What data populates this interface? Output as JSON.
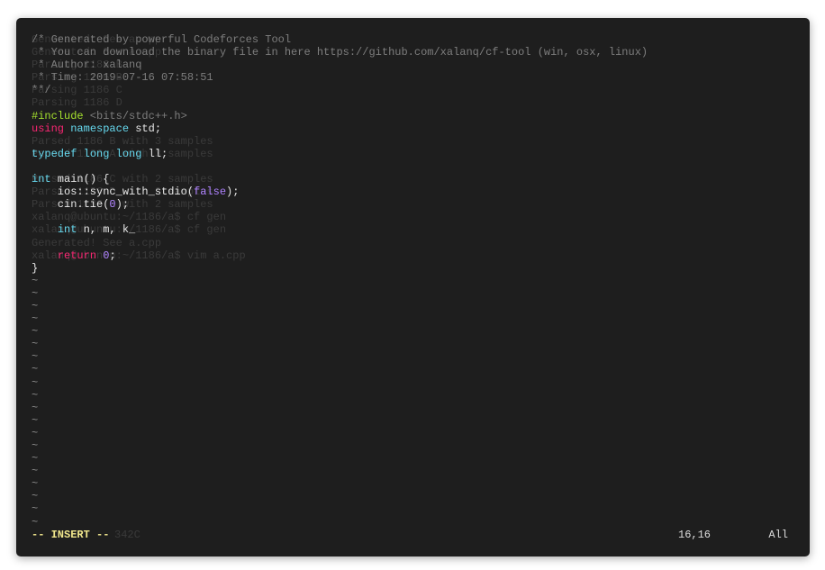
{
  "background_output": [
    "Generated: See a.cpp",
    "Generated: See a.cpp",
    "Parsing 1186 B",
    "Parsing 1186 B",
    "Parsing 1186 C",
    "Parsing 1186 D",
    "",
    "",
    "Parsed 1186 B with 3 samples",
    "Parsed 1186 A with 3 samples",
    "",
    "Parsed 1186 C with 2 samples",
    "Parsed 1186 D with 2 samples",
    "Parsed 1186 E with 2 samples",
    "xalanq@ubuntu:~/1186/a$ cf gen",
    "xalanq@ubuntu:~/1186/a$ cf gen",
    "Generated! See a.cpp",
    "xalanq@ubuntu:~/1186/a$ vim a.cpp",
    "}",
    "",
    "",
    ""
  ],
  "editor": {
    "lines": [
      [
        {
          "t": "/* Generated by powerful Codeforces Tool",
          "c": "comment"
        }
      ],
      [
        {
          "t": " * You can download the binary file in here https://github.com/xalanq/cf-tool (win, osx, linux)",
          "c": "comment"
        }
      ],
      [
        {
          "t": " * Author: xalanq",
          "c": "comment"
        }
      ],
      [
        {
          "t": " * Time: 2019-07-16 07:58:51",
          "c": "comment"
        }
      ],
      [
        {
          "t": "**/",
          "c": "comment"
        }
      ],
      [],
      [
        {
          "t": "#include",
          "c": "pre"
        },
        {
          "t": " <bits/stdc++.h>",
          "c": "comment"
        }
      ],
      [
        {
          "t": "using",
          "c": "key"
        },
        {
          "t": " ",
          "c": ""
        },
        {
          "t": "namespace",
          "c": "type"
        },
        {
          "t": " std;",
          "c": ""
        }
      ],
      [],
      [
        {
          "t": "typedef",
          "c": "type"
        },
        {
          "t": " ",
          "c": ""
        },
        {
          "t": "long",
          "c": "type"
        },
        {
          "t": " ",
          "c": ""
        },
        {
          "t": "long",
          "c": "type"
        },
        {
          "t": " ll;",
          "c": ""
        }
      ],
      [],
      [
        {
          "t": "int",
          "c": "type"
        },
        {
          "t": " main() {",
          "c": ""
        }
      ],
      [
        {
          "t": "    ios::sync_with_stdio(",
          "c": ""
        },
        {
          "t": "false",
          "c": "num"
        },
        {
          "t": ");",
          "c": ""
        }
      ],
      [
        {
          "t": "    cin.tie(",
          "c": ""
        },
        {
          "t": "0",
          "c": "num"
        },
        {
          "t": ");",
          "c": ""
        }
      ],
      [],
      [
        {
          "t": "    ",
          "c": ""
        },
        {
          "t": "int",
          "c": "type"
        },
        {
          "t": " n, m, k_",
          "c": ""
        }
      ],
      [],
      [
        {
          "t": "    ",
          "c": ""
        },
        {
          "t": "return",
          "c": "key"
        },
        {
          "t": " ",
          "c": ""
        },
        {
          "t": "0",
          "c": "num"
        },
        {
          "t": ";",
          "c": ""
        }
      ],
      [
        {
          "t": "}",
          "c": ""
        }
      ]
    ],
    "tilde": "~",
    "tilde_count": 20
  },
  "status": {
    "mode": "-- INSERT --",
    "ghost": "342C",
    "position": "16,16",
    "scroll": "All"
  },
  "colors": {
    "background": "#1e1e1e",
    "comment": "#7d7d7d",
    "preprocessor": "#a6e22e",
    "keyword": "#f92672",
    "type": "#66d9ef",
    "number": "#ae81ff",
    "insert_mode": "#f0e68c"
  }
}
